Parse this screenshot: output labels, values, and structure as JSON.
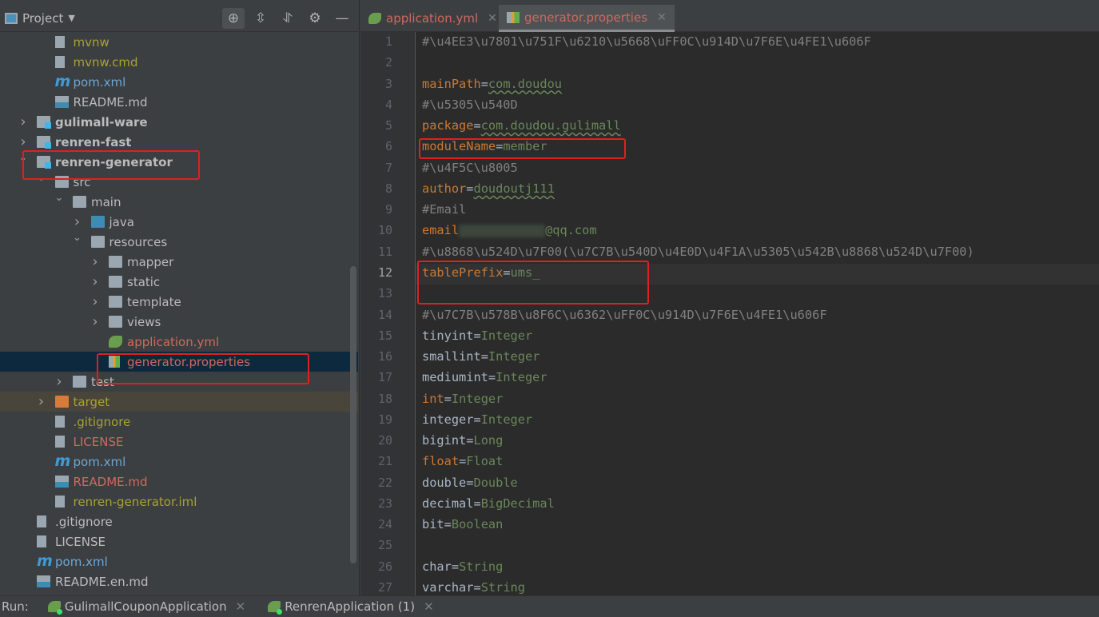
{
  "project_panel": {
    "title": "Project",
    "toolbar_icons": [
      "locate-icon",
      "expand-all-icon",
      "collapse-all-icon",
      "gear-icon",
      "minimize-icon"
    ],
    "tree": [
      {
        "label": "mvnw",
        "level": 1,
        "icon": "terminal-file",
        "color": "yellow"
      },
      {
        "label": "mvnw.cmd",
        "level": 1,
        "icon": "text-file",
        "color": "yellow"
      },
      {
        "label": "pom.xml",
        "level": 1,
        "icon": "maven-file",
        "color": "blue"
      },
      {
        "label": "README.md",
        "level": 1,
        "icon": "markdown-file",
        "color": "white"
      },
      {
        "label": "gulimall-ware",
        "level": 0,
        "icon": "module-folder",
        "arrow": "collapsed",
        "bold": true
      },
      {
        "label": "renren-fast",
        "level": 0,
        "icon": "module-folder",
        "arrow": "collapsed",
        "bold": true
      },
      {
        "label": "renren-generator",
        "level": 0,
        "icon": "module-folder",
        "arrow": "expanded",
        "bold": true,
        "highlighted": true
      },
      {
        "label": "src",
        "level": 1,
        "icon": "folder",
        "arrow": "expanded"
      },
      {
        "label": "main",
        "level": 2,
        "icon": "folder",
        "arrow": "expanded"
      },
      {
        "label": "java",
        "level": 3,
        "icon": "source-folder",
        "arrow": "collapsed"
      },
      {
        "label": "resources",
        "level": 3,
        "icon": "resources-folder",
        "arrow": "expanded"
      },
      {
        "label": "mapper",
        "level": 4,
        "icon": "folder",
        "arrow": "collapsed"
      },
      {
        "label": "static",
        "level": 4,
        "icon": "folder",
        "arrow": "collapsed"
      },
      {
        "label": "template",
        "level": 4,
        "icon": "folder",
        "arrow": "collapsed"
      },
      {
        "label": "views",
        "level": 4,
        "icon": "folder",
        "arrow": "collapsed"
      },
      {
        "label": "application.yml",
        "level": 4,
        "icon": "spring-yml-file",
        "color": "red"
      },
      {
        "label": "generator.properties",
        "level": 4,
        "icon": "properties-file",
        "color": "red",
        "selected": true,
        "highlighted": true
      },
      {
        "label": "test",
        "level": 2,
        "icon": "folder",
        "arrow": "collapsed"
      },
      {
        "label": "target",
        "level": 1,
        "icon": "excluded-folder",
        "arrow": "collapsed",
        "color": "yellow",
        "excluded": true
      },
      {
        "label": ".gitignore",
        "level": 1,
        "icon": "ignore-file",
        "color": "yellow"
      },
      {
        "label": "LICENSE",
        "level": 1,
        "icon": "text-file",
        "color": "red"
      },
      {
        "label": "pom.xml",
        "level": 1,
        "icon": "maven-file",
        "color": "blue"
      },
      {
        "label": "README.md",
        "level": 1,
        "icon": "markdown-file",
        "color": "red"
      },
      {
        "label": "renren-generator.iml",
        "level": 1,
        "icon": "iml-file",
        "color": "yellow"
      },
      {
        "label": ".gitignore",
        "level": 0,
        "icon": "ignore-file",
        "color": "white"
      },
      {
        "label": "LICENSE",
        "level": 0,
        "icon": "text-file",
        "color": "white"
      },
      {
        "label": "pom.xml",
        "level": 0,
        "icon": "maven-file",
        "color": "blue"
      },
      {
        "label": "README.en.md",
        "level": 0,
        "icon": "markdown-file",
        "color": "white"
      }
    ]
  },
  "editor": {
    "tabs": [
      {
        "label": "application.yml",
        "icon": "spring-yml-icon",
        "active": false
      },
      {
        "label": "generator.properties",
        "icon": "properties-file-icon",
        "active": true
      }
    ],
    "current_line": 12,
    "lines": [
      {
        "n": 1,
        "comment": "#\\u4EE3\\u7801\\u751F\\u6210\\u5668\\uFF0C\\u914D\\u7F6E\\u4FE1\\u606F"
      },
      {
        "n": 2
      },
      {
        "n": 3,
        "key": "mainPath",
        "kw": true,
        "value": "com.doudou",
        "wavy": "doudou"
      },
      {
        "n": 4,
        "comment": "#\\u5305\\u540D"
      },
      {
        "n": 5,
        "key": "package",
        "kw": true,
        "value": "com.doudou.gulimall",
        "wavy": "doudou.gulimall"
      },
      {
        "n": 6,
        "key": "moduleName",
        "kw": true,
        "value": "member",
        "highlighted": true
      },
      {
        "n": 7,
        "comment": "#\\u4F5C\\u8005"
      },
      {
        "n": 8,
        "key": "author",
        "kw": true,
        "value": "doudoutj111",
        "wavy": "doudoutj"
      },
      {
        "n": 9,
        "comment": "#Email"
      },
      {
        "n": 10,
        "key": "email",
        "kw": true,
        "redacted": true,
        "value": "@qq.com"
      },
      {
        "n": 11,
        "comment": "#\\u8868\\u524D\\u7F00(\\u7C7B\\u540D\\u4E0D\\u4F1A\\u5305\\u542B\\u8868\\u524D\\u7F00)"
      },
      {
        "n": 12,
        "key": "tablePrefix",
        "kw": true,
        "value": "ums_",
        "highlighted": true
      },
      {
        "n": 13
      },
      {
        "n": 14,
        "comment": "#\\u7C7B\\u578B\\u8F6C\\u6362\\uFF0C\\u914D\\u7F6E\\u4FE1\\u606F"
      },
      {
        "n": 15,
        "key": "tinyint",
        "value": "Integer"
      },
      {
        "n": 16,
        "key": "smallint",
        "value": "Integer"
      },
      {
        "n": 17,
        "key": "mediumint",
        "value": "Integer"
      },
      {
        "n": 18,
        "key": "int",
        "kw": true,
        "value": "Integer"
      },
      {
        "n": 19,
        "key": "integer",
        "value": "Integer"
      },
      {
        "n": 20,
        "key": "bigint",
        "value": "Long"
      },
      {
        "n": 21,
        "key": "float",
        "kw": true,
        "value": "Float"
      },
      {
        "n": 22,
        "key": "double",
        "value": "Double"
      },
      {
        "n": 23,
        "key": "decimal",
        "value": "BigDecimal"
      },
      {
        "n": 24,
        "key": "bit",
        "value": "Boolean"
      },
      {
        "n": 25
      },
      {
        "n": 26,
        "key": "char",
        "value": "String"
      },
      {
        "n": 27,
        "key": "varchar",
        "value": "String"
      }
    ]
  },
  "run_bar": {
    "label": "Run:",
    "tabs": [
      {
        "label": "GulimallCouponApplication"
      },
      {
        "label": "RenrenApplication (1)"
      }
    ]
  },
  "colors": {
    "keyword": "#cc7832",
    "value": "#6a8759",
    "comment": "#808080",
    "highlight_box": "#e02020",
    "selection": "#0d293e"
  }
}
